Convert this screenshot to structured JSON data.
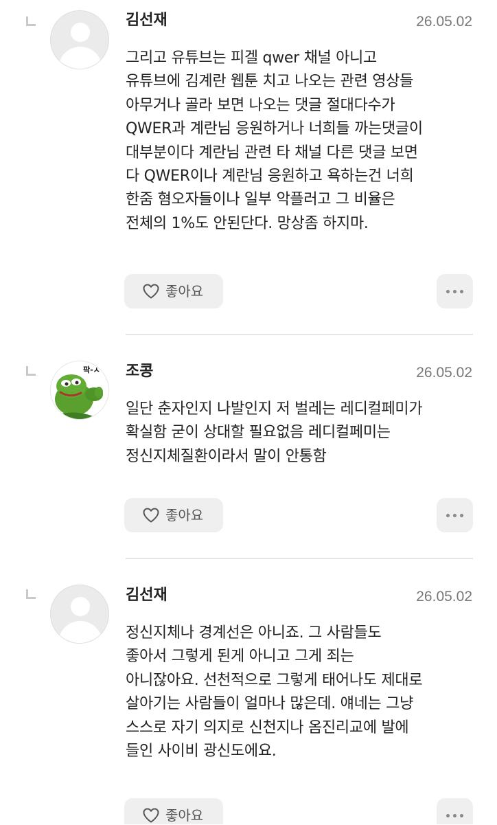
{
  "comments": [
    {
      "author": "김선재",
      "date": "26.05.02",
      "avatar": "default-user-icon",
      "text": "그리고 유튜브는 피겔 qwer 채널 아니고\n유튜브에 김계란 웹툰 치고 나오는 관련 영상들\n아무거나 골라 보면 나오는 댓글 절대다수가\nQWER과 계란님 응원하거나 너희들 까는댓글이\n대부분이다 계란님 관련 타 채널 다른 댓글 보면\n다 QWER이나 계란님 응원하고 욕하는건 너희\n한줌 혐오자들이나 일부 악플러고 그 비율은\n전체의 1%도 안된단다. 망상좀 하지마.",
      "like_label": "좋아요"
    },
    {
      "author": "조콩",
      "date": "26.05.02",
      "avatar": "pepe-frog-image",
      "avatar_caption": "팍-ㅅ",
      "text": "일단 춘자인지 나발인지 저 벌레는 레디컬페미가\n확실함 굳이 상대할 필요없음 레디컬페미는\n정신지체질환이라서 말이 안통함",
      "like_label": "좋아요"
    },
    {
      "author": "김선재",
      "date": "26.05.02",
      "avatar": "default-user-icon",
      "text": "정신지체나 경계선은 아니죠. 그 사람들도\n좋아서 그렇게 된게 아니고 그게 죄는\n아니잖아요. 선천적으로 그렇게 태어나도 제대로\n살아기는 사람들이 얼마나 많은데. 얘네는 그냥\n스스로 자기 의지로 신천지나 옴진리교에 발에\n들인 사이비 광신도에요.",
      "like_label": "좋아요"
    }
  ],
  "colors": {
    "background": "#ffffff",
    "text": "#222222",
    "date": "#777777",
    "button_bg": "#efefef",
    "divider": "#e6e6e6"
  }
}
